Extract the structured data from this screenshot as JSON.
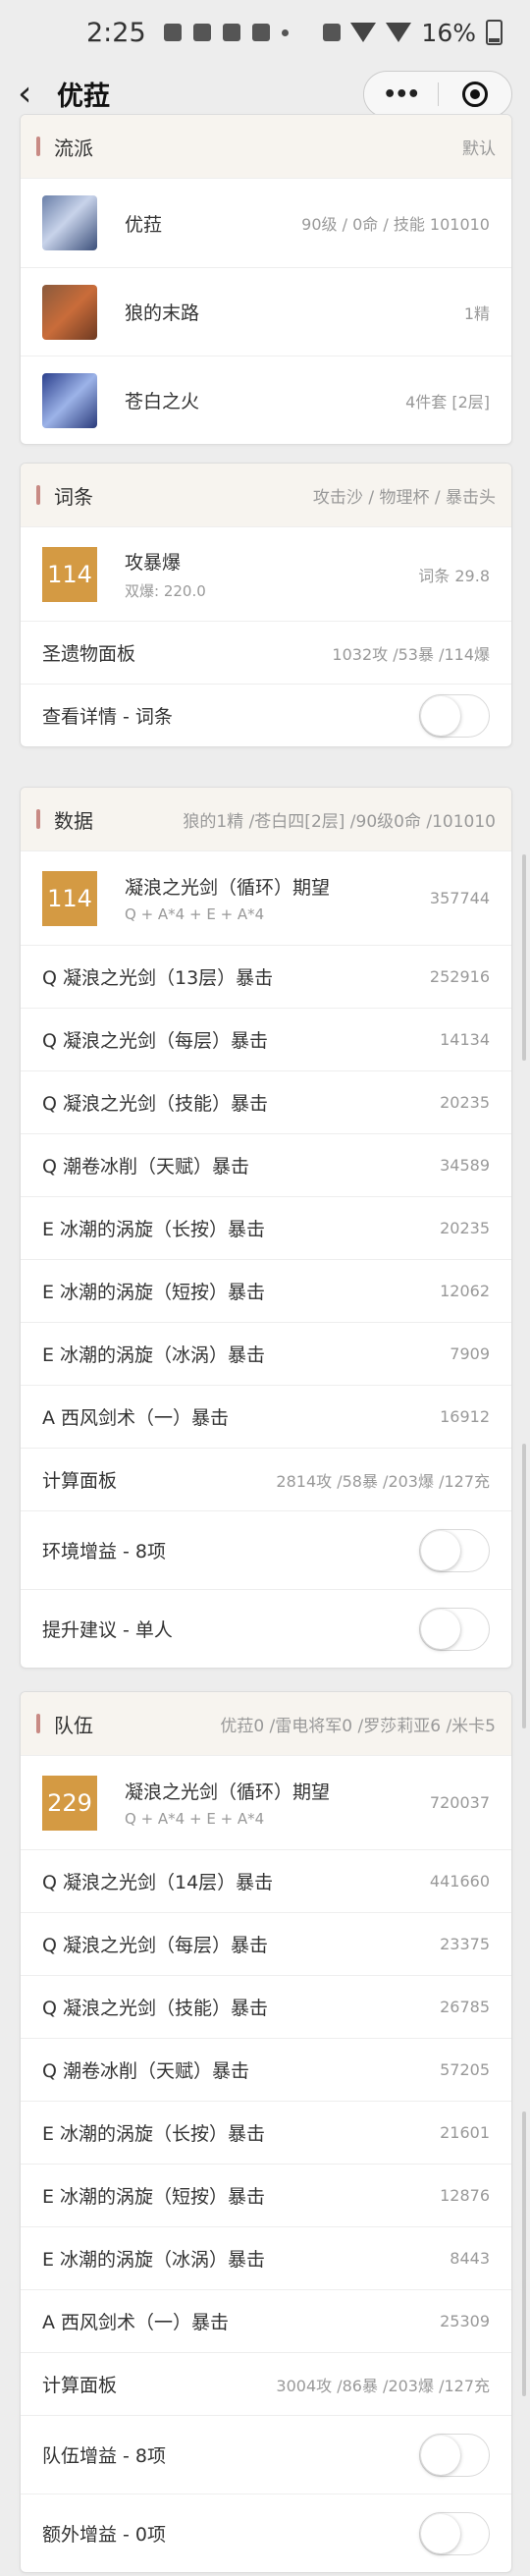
{
  "status": {
    "time": "2:25",
    "battery": "16%"
  },
  "nav": {
    "back": "‹",
    "title": "优菈"
  },
  "school": {
    "title": "流派",
    "sub": "默认",
    "rows": [
      {
        "label": "优菈",
        "value": "90级 / 0命 / 技能 101010"
      },
      {
        "label": "狼的末路",
        "value": "1精"
      },
      {
        "label": "苍白之火",
        "value": "4件套 [2层]"
      }
    ]
  },
  "entry": {
    "title": "词条",
    "sub": "攻击沙 / 物理杯 / 暴击头",
    "top": {
      "badge": "114",
      "main": "攻暴爆",
      "sub": "双爆: 220.0",
      "value": "词条 29.8"
    },
    "panel": {
      "label": "圣遗物面板",
      "value": "1032攻 /53暴 /114爆"
    },
    "detail": {
      "label": "查看详情 - 词条"
    }
  },
  "data": {
    "title": "数据",
    "sub": "狼的1精 /苍白四[2层] /90级0命 /101010",
    "top": {
      "badge": "114",
      "main": "凝浪之光剑（循环）期望",
      "sub": "Q + A*4 + E + A*4",
      "value": "357744"
    },
    "rows": [
      {
        "label": "Q 凝浪之光剑（13层）暴击",
        "value": "252916"
      },
      {
        "label": "Q 凝浪之光剑（每层）暴击",
        "value": "14134"
      },
      {
        "label": "Q 凝浪之光剑（技能）暴击",
        "value": "20235"
      },
      {
        "label": "Q 潮卷冰削（天赋）暴击",
        "value": "34589"
      },
      {
        "label": "E 冰潮的涡旋（长按）暴击",
        "value": "20235"
      },
      {
        "label": "E 冰潮的涡旋（短按）暴击",
        "value": "12062"
      },
      {
        "label": "E 冰潮的涡旋（冰涡）暴击",
        "value": "7909"
      },
      {
        "label": "A 西风剑术（一）暴击",
        "value": "16912"
      },
      {
        "label": "计算面板",
        "value": "2814攻 /58暴 /203爆 /127充"
      }
    ],
    "toggles": [
      {
        "label": "环境增益 - 8项"
      },
      {
        "label": "提升建议 - 单人"
      }
    ]
  },
  "team": {
    "title": "队伍",
    "sub": "优菈0 /雷电将军0 /罗莎莉亚6 /米卡5",
    "top": {
      "badge": "229",
      "main": "凝浪之光剑（循环）期望",
      "sub": "Q + A*4 + E + A*4",
      "value": "720037"
    },
    "rows": [
      {
        "label": "Q 凝浪之光剑（14层）暴击",
        "value": "441660"
      },
      {
        "label": "Q 凝浪之光剑（每层）暴击",
        "value": "23375"
      },
      {
        "label": "Q 凝浪之光剑（技能）暴击",
        "value": "26785"
      },
      {
        "label": "Q 潮卷冰削（天赋）暴击",
        "value": "57205"
      },
      {
        "label": "E 冰潮的涡旋（长按）暴击",
        "value": "21601"
      },
      {
        "label": "E 冰潮的涡旋（短按）暴击",
        "value": "12876"
      },
      {
        "label": "E 冰潮的涡旋（冰涡）暴击",
        "value": "8443"
      },
      {
        "label": "A 西风剑术（一）暴击",
        "value": "25309"
      },
      {
        "label": "计算面板",
        "value": "3004攻 /86暴 /203爆 /127充"
      }
    ],
    "toggles": [
      {
        "label": "队伍增益 - 8项"
      },
      {
        "label": "额外增益 - 0项"
      }
    ]
  },
  "colors": {
    "accent": "#d49a43",
    "header_bg": "#f7f4ef",
    "bar": "#c88a84"
  }
}
